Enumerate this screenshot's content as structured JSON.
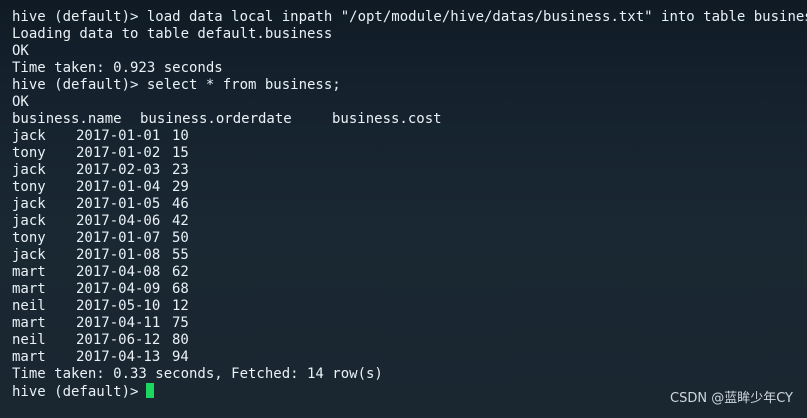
{
  "terminal": {
    "lines_before": [
      "hive (default)> load data local inpath \"/opt/module/hive/datas/business.txt\" into table business;",
      "Loading data to table default.business",
      "OK",
      "Time taken: 0.923 seconds",
      "hive (default)> select * from business;",
      "OK"
    ],
    "table": {
      "headers": [
        "business.name",
        "business.orderdate",
        "business.cost"
      ],
      "rows": [
        [
          "jack",
          "2017-01-01",
          "10"
        ],
        [
          "tony",
          "2017-01-02",
          "15"
        ],
        [
          "jack",
          "2017-02-03",
          "23"
        ],
        [
          "tony",
          "2017-01-04",
          "29"
        ],
        [
          "jack",
          "2017-01-05",
          "46"
        ],
        [
          "jack",
          "2017-04-06",
          "42"
        ],
        [
          "tony",
          "2017-01-07",
          "50"
        ],
        [
          "jack",
          "2017-01-08",
          "55"
        ],
        [
          "mart",
          "2017-04-08",
          "62"
        ],
        [
          "mart",
          "2017-04-09",
          "68"
        ],
        [
          "neil",
          "2017-05-10",
          "12"
        ],
        [
          "mart",
          "2017-04-11",
          "75"
        ],
        [
          "neil",
          "2017-06-12",
          "80"
        ],
        [
          "mart",
          "2017-04-13",
          "94"
        ]
      ]
    },
    "summary": "Time taken: 0.33 seconds, Fetched: 14 row(s)",
    "prompt": "hive (default)>",
    "cursor_color": "#1bd65f"
  },
  "watermark": "CSDN @蓝眸少年CY",
  "colors": {
    "background": "#1a2833",
    "text": "#e9f1f6"
  }
}
